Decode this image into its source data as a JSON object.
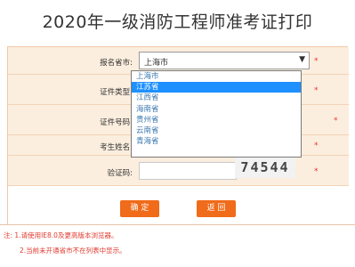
{
  "title": "2020年一级消防工程师准考证打印",
  "form": {
    "province_label": "报名省市:",
    "province_value": "上海市",
    "province_options": [
      "上海市",
      "江苏省",
      "江西省",
      "海南省",
      "贵州省",
      "云南省",
      "青海省"
    ],
    "province_highlighted": "江苏省",
    "id_type_label": "证件类型:",
    "id_number_label": "证件号码:",
    "name_label": "考生姓名:",
    "captcha_label": "验证码:",
    "captcha_text": "74544",
    "required_mark": "*"
  },
  "buttons": {
    "confirm": "确 定",
    "back": "返 回"
  },
  "notes": {
    "line1": "注: 1.请使用IE8.0及更高版本浏览器。",
    "line2": "2.当前未开通省市不在列表中显示。"
  },
  "colors": {
    "accent": "#f06b1a",
    "row_bg": "#fbeede",
    "highlight": "#1e90ff",
    "note_text": "#e03a2e"
  }
}
